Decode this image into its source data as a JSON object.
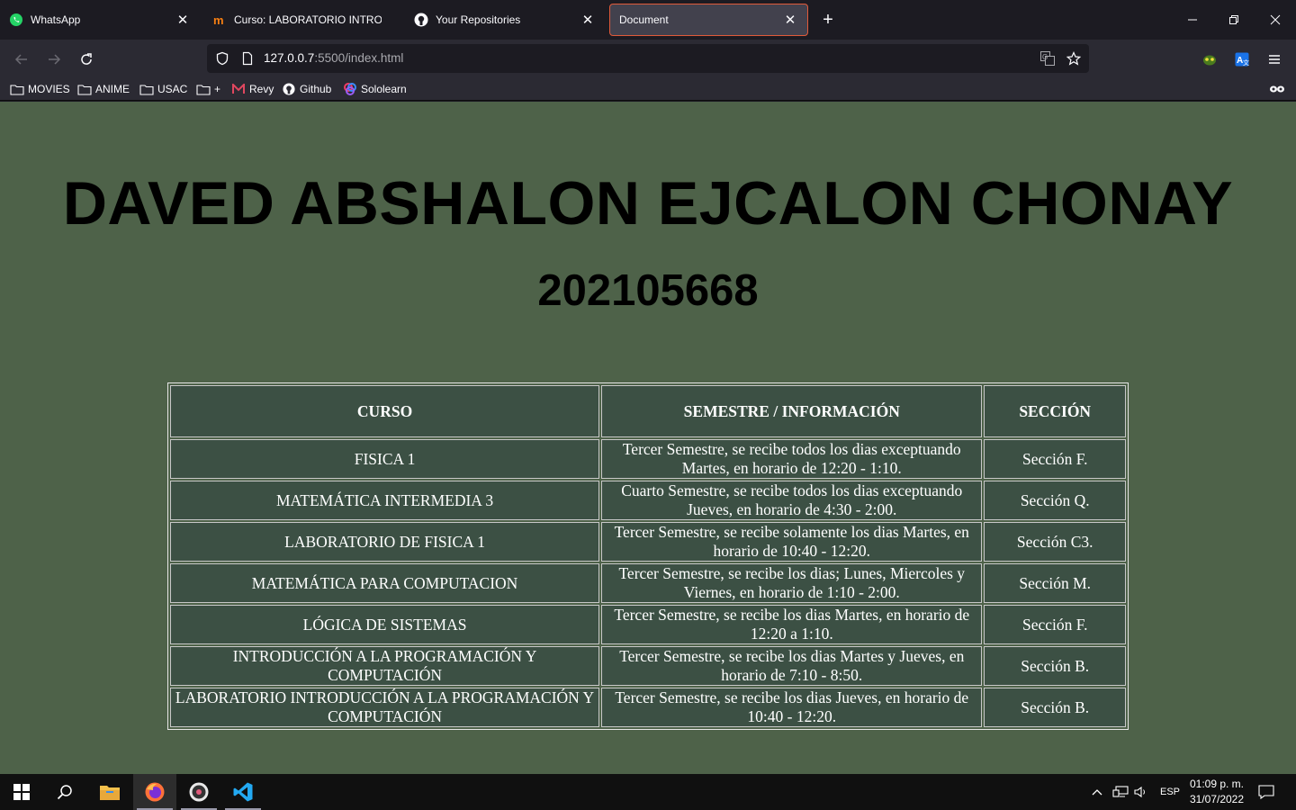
{
  "browser": {
    "tabs": [
      {
        "title": "WhatsApp",
        "icon": "whatsapp-icon",
        "active": false
      },
      {
        "title": "Curso: LABORATORIO INTRODU",
        "icon": "moodle-icon",
        "active": false
      },
      {
        "title": "Your Repositories",
        "icon": "github-icon",
        "active": false
      },
      {
        "title": "Document",
        "icon": "none",
        "active": true
      }
    ],
    "url_host": "127.0.0.7",
    "url_rest": ":5500/index.html",
    "bookmarks": [
      {
        "label": "MOVIES",
        "icon": "folder-icon"
      },
      {
        "label": "ANIME",
        "icon": "folder-icon"
      },
      {
        "label": "USAC",
        "icon": "folder-icon"
      },
      {
        "label": "+",
        "icon": "folder-icon"
      },
      {
        "label": "Revy",
        "icon": "revy-icon"
      },
      {
        "label": "Github",
        "icon": "github-icon"
      },
      {
        "label": "Sololearn",
        "icon": "sololearn-icon"
      }
    ],
    "accent_color": "#e05a3a"
  },
  "page": {
    "name": "DAVED ABSHALON EJCALON CHONAY",
    "carnet": "202105668",
    "background_color": "#4e6249",
    "table": {
      "headers": [
        "CURSO",
        "SEMESTRE / INFORMACIÓN",
        "SECCIÓN"
      ],
      "rows": [
        [
          "FISICA 1",
          "Tercer Semestre, se recibe todos los dias exceptuando Martes, en horario de 12:20 - 1:10.",
          "Sección F."
        ],
        [
          "MATEMÁTICA INTERMEDIA 3",
          "Cuarto Semestre, se recibe todos los dias exceptuando Jueves, en horario de 4:30 - 2:00.",
          "Sección Q."
        ],
        [
          "LABORATORIO DE FISICA 1",
          "Tercer Semestre, se recibe solamente los dias Martes, en horario de 10:40 - 12:20.",
          "Sección C3."
        ],
        [
          "MATEMÁTICA PARA COMPUTACION",
          "Tercer Semestre, se recibe los dias; Lunes, Miercoles y Viernes, en horario de 1:10 - 2:00.",
          "Sección M."
        ],
        [
          "LÓGICA DE SISTEMAS",
          "Tercer Semestre, se recibe los dias Martes, en horario de 12:20 a 1:10.",
          "Sección F."
        ],
        [
          "INTRODUCCIÓN A LA PROGRAMACIÓN Y COMPUTACIÓN",
          "Tercer Semestre, se recibe los dias Martes y Jueves, en horario de 7:10 - 8:50.",
          "Sección B."
        ],
        [
          "LABORATORIO INTRODUCCIÓN A LA PROGRAMACIÓN Y COMPUTACIÓN",
          "Tercer Semestre, se recibe los dias Jueves, en horario de 10:40 - 12:20.",
          "Sección B."
        ]
      ]
    }
  },
  "taskbar": {
    "apps": [
      "start-icon",
      "search-icon",
      "file-explorer-icon",
      "firefox-icon",
      "media-player-icon",
      "vscode-icon"
    ],
    "language": "ESP",
    "time": "01:09 p. m.",
    "date": "31/07/2022"
  }
}
